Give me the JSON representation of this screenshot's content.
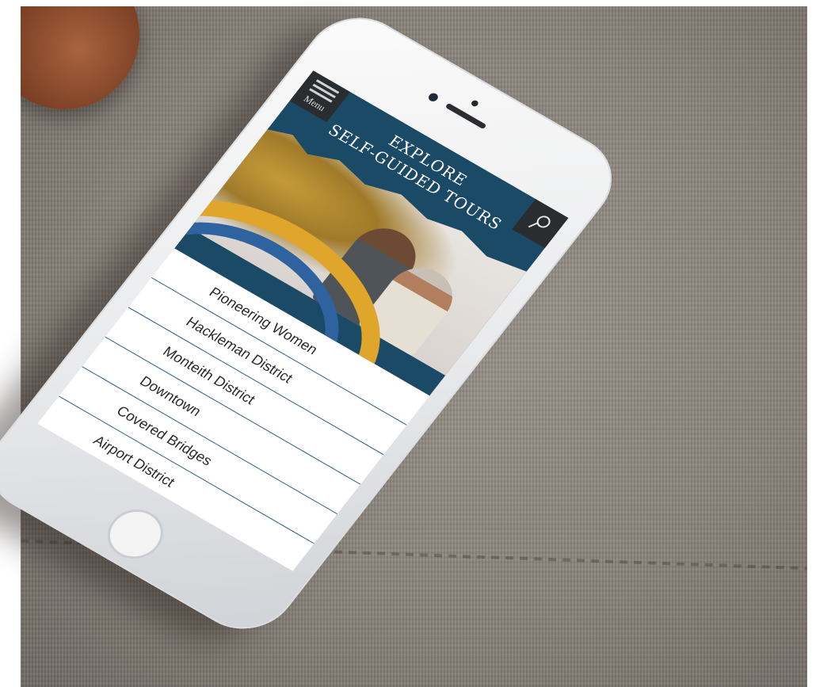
{
  "header": {
    "menu_label": "Menu",
    "title_line1": "EXPLORE",
    "title_line2": "SELF-GUIDED TOURS",
    "search_icon": "search-icon"
  },
  "tours": [
    {
      "label": "Pioneering Women"
    },
    {
      "label": "Hackleman District"
    },
    {
      "label": "Monteith District"
    },
    {
      "label": "Downtown"
    },
    {
      "label": "Covered Bridges"
    },
    {
      "label": "Airport District"
    }
  ],
  "colors": {
    "header_blue": "#1b4a66",
    "accent_gold": "#e0a52b",
    "accent_blue": "#2f63a0",
    "menu_dark": "#2a2d30",
    "divider": "#2c5f86"
  }
}
